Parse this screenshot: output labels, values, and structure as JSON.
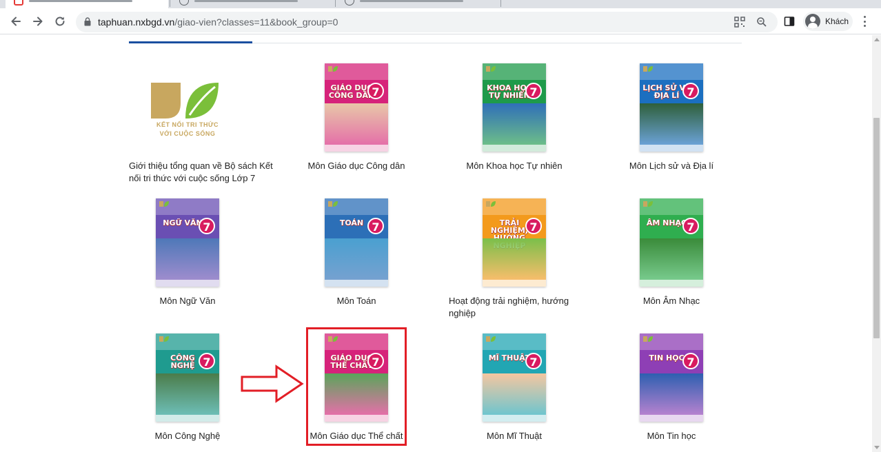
{
  "browser": {
    "url_host": "taphuan.nxbgd.vn",
    "url_path": "/giao-vien?classes=11&book_group=0",
    "profile_name": "Khách"
  },
  "colors": {
    "accent": "#1a4fa0",
    "highlight_box": "#e21e26"
  },
  "books": [
    {
      "title": "Giới thiệu tổng quan về Bộ sách Kết nối tri thức với cuộc sống Lớp 7",
      "type": "logo",
      "logo_line1": "KẾT NỐI TRI THỨC",
      "logo_line2": "VỚI CUỘC SỐNG"
    },
    {
      "title": "Môn Giáo dục Công dân",
      "cover_title": "GIÁO DỤC CÔNG DÂN",
      "grade": "7",
      "color": "#d6237a",
      "scene": "#e8c7a8"
    },
    {
      "title": "Môn Khoa học Tự nhiên",
      "cover_title": "KHOA HỌC TỰ NHIÊN",
      "grade": "7",
      "color": "#1e9a4a",
      "scene": "#2f6fb8"
    },
    {
      "title": "Môn Lịch sử và Địa lí",
      "cover_title": "LỊCH SỬ VÀ ĐỊA LÍ",
      "grade": "7",
      "color": "#1b6fc0",
      "scene": "#2e5f3a"
    },
    {
      "title": "Môn Ngữ Văn",
      "cover_title": "NGỮ VĂN",
      "grade": "7",
      "color": "#6a4fb3",
      "scene": "#4e78b8"
    },
    {
      "title": "Môn Toán",
      "cover_title": "TOÁN",
      "grade": "7",
      "color": "#2c6fb7",
      "scene": "#4aa0d0"
    },
    {
      "title": "Hoạt động trải nghiệm, hướng nghiệp",
      "cover_title": "TRẢI NGHIỆM, HƯỚNG NGHIỆP",
      "grade": "7",
      "color": "#f39a1c",
      "scene": "#7bbf4a"
    },
    {
      "title": "Môn Âm Nhạc",
      "cover_title": "ÂM NHẠC",
      "grade": "7",
      "color": "#2fae4f",
      "scene": "#3a8b3a"
    },
    {
      "title": "Môn Công Nghệ",
      "cover_title": "CÔNG NGHỆ",
      "grade": "7",
      "color": "#1f9b8f",
      "scene": "#4b7c4a"
    },
    {
      "title": "Môn Giáo dục Thể chất",
      "cover_title": "GIÁO DỤC THỂ CHẤT",
      "grade": "7",
      "color": "#d6237a",
      "scene": "#5aa55a"
    },
    {
      "title": "Môn Mĩ Thuật",
      "cover_title": "MĨ THUẬT",
      "grade": "7",
      "color": "#22a6b3",
      "scene": "#f4c6a0"
    },
    {
      "title": "Môn Tin học",
      "cover_title": "TIN HỌC",
      "grade": "7",
      "color": "#8e3fb5",
      "scene": "#2e5fb0"
    }
  ],
  "icons": [
    "back-icon",
    "forward-icon",
    "reload-icon",
    "lock-icon",
    "qr-code-icon",
    "zoom-icon",
    "sidepanel-icon",
    "avatar-icon",
    "more-menu-icon",
    "arrow-right-icon"
  ]
}
